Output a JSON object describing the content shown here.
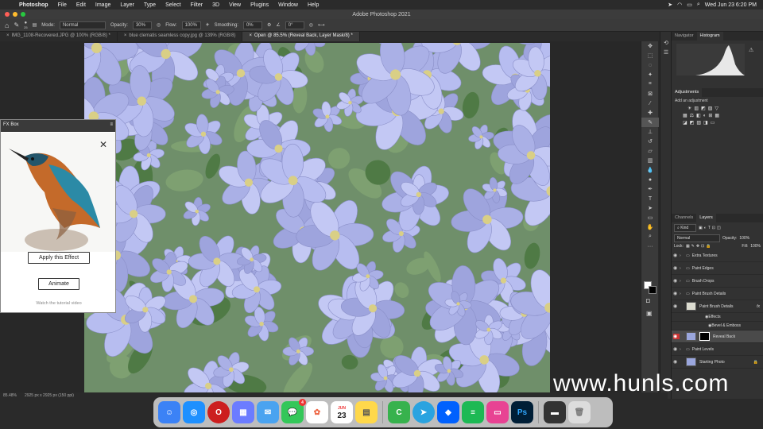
{
  "menubar": {
    "app": "Photoshop",
    "items": [
      "File",
      "Edit",
      "Image",
      "Layer",
      "Type",
      "Select",
      "Filter",
      "3D",
      "View",
      "Plugins",
      "Window",
      "Help"
    ],
    "clock": "Wed Jun 23  6:20 PM"
  },
  "window": {
    "title": "Adobe Photoshop 2021"
  },
  "options": {
    "brush_size": "25",
    "mode_label": "Mode:",
    "mode_value": "Normal",
    "opacity_label": "Opacity:",
    "opacity_value": "30%",
    "flow_label": "Flow:",
    "flow_value": "100%",
    "smoothing_label": "Smoothing:",
    "smoothing_value": "0%",
    "angle_value": "0°"
  },
  "tabs": [
    {
      "label": "IMG_1108-Recovered.JPG @ 100% (RGB/8) *"
    },
    {
      "label": "blue clematis seamless copy.jpg @ 139% (RGB/8)"
    },
    {
      "label": "Open @ 85.5% (Reveal Back, Layer Mask/8) *"
    }
  ],
  "fx": {
    "title": "FX Box",
    "apply_label": "Apply this Effect",
    "animate_label": "Animate",
    "tutorial_label": "Watch the tutorial video"
  },
  "panels": {
    "top_tabs": [
      "Navigator",
      "Histogram"
    ],
    "adjust_tab": "Adjustments",
    "adjust_hint": "Add an adjustment",
    "layer_tabs": [
      "Channels",
      "Layers"
    ],
    "kind": "Kind",
    "blend": "Normal",
    "opacity_label": "Opacity:",
    "opacity_value": "100%",
    "lock_label": "Lock:",
    "fill_label": "Fill:",
    "fill_value": "100%"
  },
  "layers": [
    {
      "name": "Extra Textures",
      "type": "group"
    },
    {
      "name": "Paint Edges",
      "type": "group"
    },
    {
      "name": "Brush Drops",
      "type": "group"
    },
    {
      "name": "Paint Brush Details",
      "type": "group"
    },
    {
      "name": "Paint Brush Details",
      "type": "layer",
      "fx": "fx"
    },
    {
      "name": "Effects",
      "type": "effects"
    },
    {
      "name": "Bevel & Emboss",
      "type": "effect"
    },
    {
      "name": "Reveal Back",
      "type": "mask"
    },
    {
      "name": "Paint Levels",
      "type": "group"
    },
    {
      "name": "Starting Photo",
      "type": "photo"
    }
  ],
  "status": {
    "zoom": "85.48%",
    "doc": "2925 px x 2925 px (150 ppi)"
  },
  "watermark": "www.hunls.com",
  "dock_badges": {
    "messages": "4",
    "calendar_day": "23",
    "calendar_month": "JUN"
  }
}
